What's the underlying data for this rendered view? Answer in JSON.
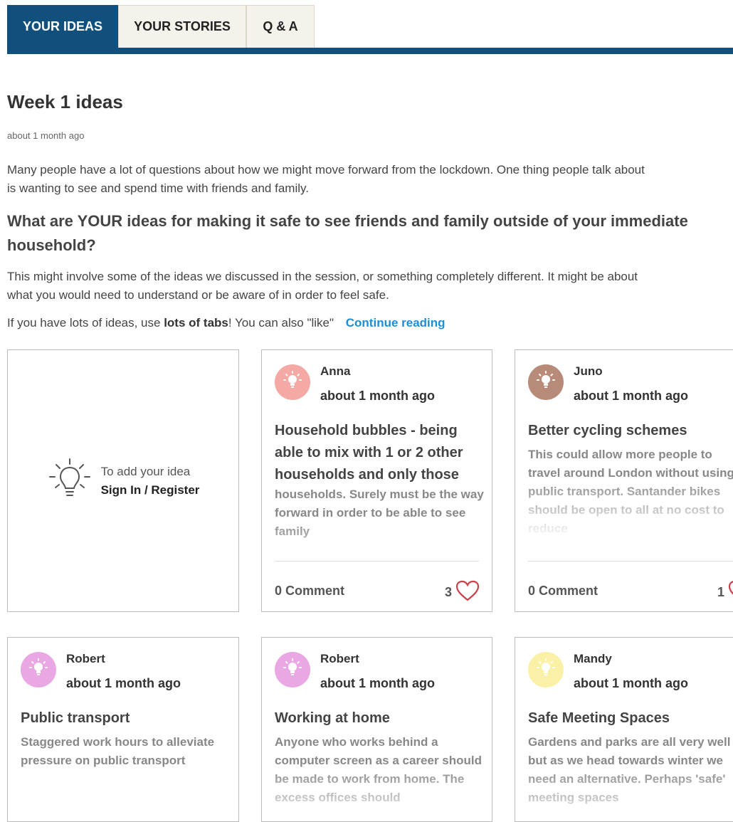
{
  "tabs": [
    "YOUR IDEAS",
    "YOUR STORIES",
    "Q & A"
  ],
  "page": {
    "title": "Week 1 ideas",
    "date": "about 1 month ago",
    "intro_line1": "Many people have a lot of questions about how we might move forward from the lockdown. One thing people talk about",
    "intro_line2": "is wanting to see and spend time with friends and family.",
    "question_line1": "What are YOUR ideas for making it safe to see friends and family outside of your immediate",
    "question_line2": "household?",
    "para_line1": "This might involve some of the ideas we discussed in the session, or something completely different. It might be about",
    "para_line2": "what you would need to understand or be aware of in order to feel safe.",
    "last_prefix": "If you have lots of ideas, use ",
    "last_bold": "lots of tabs",
    "last_suffix": "! You can also \"like\"",
    "continue_label": "Continue reading"
  },
  "add_card": {
    "line1": "To add your idea",
    "line2": "Sign In / Register"
  },
  "ideas": [
    {
      "author": "Anna",
      "time": "about 1 month ago",
      "title": "Household bubbles - being able to mix with 1 or 2 other households and only those",
      "body": "households. Surely must be the way forward in order to be able to see family",
      "comments": "0 Comment",
      "likes": "3",
      "avatar_color": "#f4a9a4"
    },
    {
      "author": "Juno",
      "time": "about 1 month ago",
      "title": "Better cycling schemes",
      "body": "This could allow more people to travel around London without using public transport. Santander bikes should be open to all at no cost to reduce",
      "comments": "0 Comment",
      "likes": "1",
      "avatar_color": "#b88a78"
    },
    {
      "author": "Robert",
      "time": "about 1 month ago",
      "title": "Public transport",
      "body": "Staggered work hours to alleviate pressure on public transport",
      "avatar_color": "#e9a8e3"
    },
    {
      "author": "Robert",
      "time": "about 1 month ago",
      "title": "Working at home",
      "body": "Anyone who works behind a computer screen as a career should be made to work from home. The excess offices should",
      "avatar_color": "#e9a8e3"
    },
    {
      "author": "Mandy",
      "time": "about 1 month ago",
      "title": "Safe Meeting Spaces",
      "body": "Gardens and parks are all very well but as we head towards winter we need an alternative. Perhaps 'safe' meeting spaces",
      "avatar_color": "#fbf1a6"
    }
  ],
  "colors": {
    "brand": "#11507c",
    "tab_inactive": "#f5f2ec",
    "link": "#1a8fd9",
    "heart": "#c9414a"
  }
}
